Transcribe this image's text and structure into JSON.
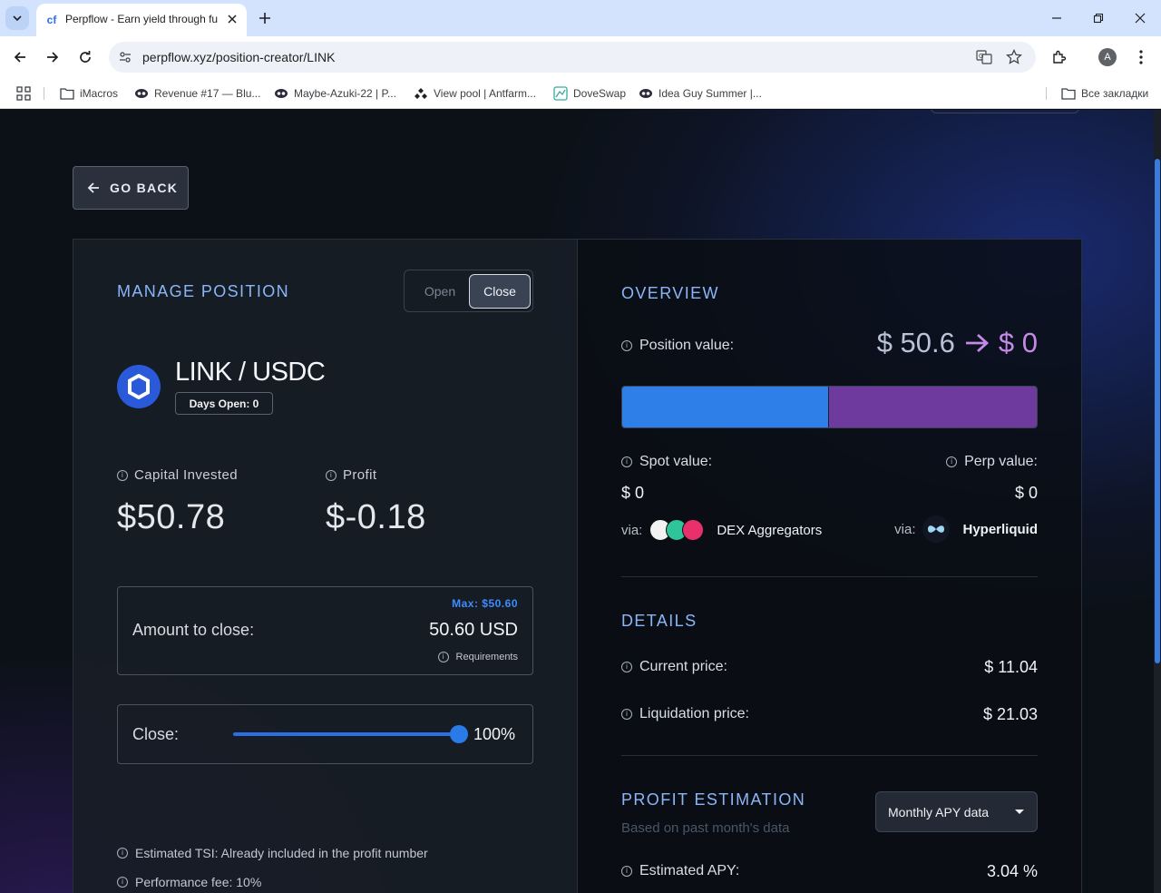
{
  "browser": {
    "tab_title": "Perpflow - Earn yield through fu",
    "url": "perpflow.xyz/position-creator/LINK",
    "avatar_letter": "A",
    "bookmarks": [
      {
        "label": "iMacros",
        "icon": "folder-icon"
      },
      {
        "label": "Revenue #17 — Blu...",
        "icon": "eyes-icon"
      },
      {
        "label": "Maybe-Azuki-22 | P...",
        "icon": "eyes-icon"
      },
      {
        "label": "View pool | Antfarm...",
        "icon": "antfarm-icon"
      },
      {
        "label": "DoveSwap",
        "icon": "doveswap-icon"
      },
      {
        "label": "Idea Guy Summer |...",
        "icon": "eyes-icon"
      }
    ],
    "all_bookmarks_label": "Все закладки"
  },
  "page": {
    "go_back_label": "GO BACK",
    "manage": {
      "title": "MANAGE POSITION",
      "toggle_open": "Open",
      "toggle_close": "Close",
      "pair": "LINK / USDC",
      "days_open": "Days Open: 0",
      "capital_label": "Capital Invested",
      "capital_value": "$50.78",
      "profit_label": "Profit",
      "profit_value": "$-0.18",
      "amount_label": "Amount to close:",
      "amount_max": "Max: $50.60",
      "amount_value": "50.60 USD",
      "requirements_label": "Requirements",
      "slider_label": "Close:",
      "slider_percent": 100,
      "slider_value": "100%",
      "notes": [
        "Estimated TSI: Already included in the profit number",
        "Performance fee: 10%"
      ]
    },
    "overview": {
      "title": "OVERVIEW",
      "position_value_label": "Position value:",
      "position_value_from": "$ 50.6",
      "position_value_to": "$ 0",
      "bar_spot_fraction": 0.497,
      "spot_label": "Spot value:",
      "spot_value": "$ 0",
      "perp_label": "Perp value:",
      "perp_value": "$ 0",
      "via_label": "via:",
      "spot_via": "DEX Aggregators",
      "perp_via": "Hyperliquid",
      "colors": {
        "spot": "#2f7fe8",
        "perp": "#6e3a9e",
        "accent": "#8ab6f8"
      }
    },
    "details": {
      "title": "DETAILS",
      "current_price_label": "Current price:",
      "current_price": "$ 11.04",
      "liquidation_price_label": "Liquidation price:",
      "liquidation_price": "$ 21.03"
    },
    "profit_estimation": {
      "title": "PROFIT ESTIMATION",
      "subtitle": "Based on past month's data",
      "dropdown_value": "Monthly APY data",
      "apy_label": "Estimated APY:",
      "apy_value": "3.04 %"
    }
  }
}
